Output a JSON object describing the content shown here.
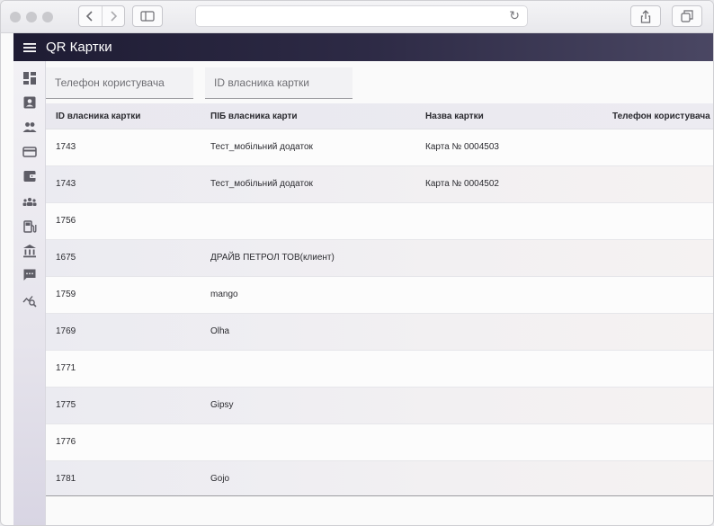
{
  "app": {
    "title": "QR Картки"
  },
  "filters": {
    "phone_placeholder": "Телефон користувача",
    "card_owner_id_placeholder": "ID власника картки"
  },
  "table": {
    "columns": [
      "ID власника картки",
      "ПІБ власника карти",
      "Назва картки",
      "Телефон користувача"
    ],
    "rows": [
      {
        "owner_id": "1743",
        "owner_name": "Тест_мобільний додаток",
        "card_name": "Карта № 0004503",
        "phone": ""
      },
      {
        "owner_id": "1743",
        "owner_name": "Тест_мобільний додаток",
        "card_name": "Карта № 0004502",
        "phone": ""
      },
      {
        "owner_id": "1756",
        "owner_name": "",
        "card_name": "",
        "phone": ""
      },
      {
        "owner_id": "1675",
        "owner_name": "ДРАЙВ ПЕТРОЛ ТОВ(клиент)",
        "card_name": "",
        "phone": ""
      },
      {
        "owner_id": "1759",
        "owner_name": "mango",
        "card_name": "",
        "phone": ""
      },
      {
        "owner_id": "1769",
        "owner_name": "Olha",
        "card_name": "",
        "phone": ""
      },
      {
        "owner_id": "1771",
        "owner_name": "",
        "card_name": "",
        "phone": ""
      },
      {
        "owner_id": "1775",
        "owner_name": "Gipsy",
        "card_name": "",
        "phone": ""
      },
      {
        "owner_id": "1776",
        "owner_name": "",
        "card_name": "",
        "phone": ""
      },
      {
        "owner_id": "1781",
        "owner_name": "Gojo",
        "card_name": "",
        "phone": ""
      }
    ]
  },
  "sidebar": {
    "icons": [
      "dashboard-icon",
      "contact-card-icon",
      "people-icon",
      "credit-card-icon",
      "wallet-icon",
      "groups-icon",
      "fuel-station-icon",
      "bank-icon",
      "chat-icon",
      "analytics-icon"
    ]
  },
  "colors": {
    "appbar_start": "#1e1c33",
    "appbar_end": "#4a4763",
    "table_header": "#e9e8ef"
  }
}
